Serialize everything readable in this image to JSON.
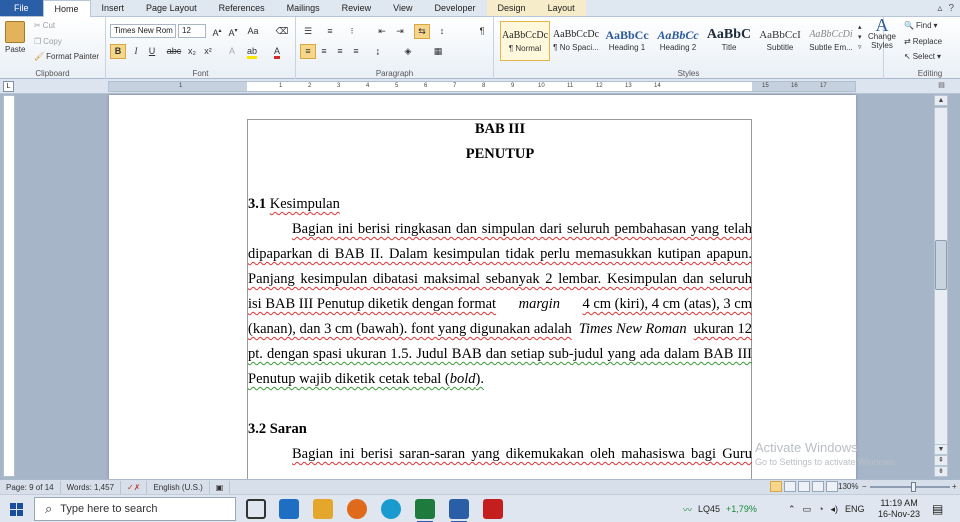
{
  "ribbon_tabs": [
    "File",
    "Home",
    "Insert",
    "Page Layout",
    "References",
    "Mailings",
    "Review",
    "View",
    "Developer",
    "Design",
    "Layout"
  ],
  "active_tab": "Home",
  "clipboard": {
    "paste": "Paste",
    "cut": "Cut",
    "copy": "Copy",
    "format_painter": "Format Painter",
    "label": "Clipboard"
  },
  "font": {
    "name": "Times New Rom",
    "size": "12",
    "label": "Font"
  },
  "paragraph": {
    "label": "Paragraph"
  },
  "styles": {
    "label": "Styles",
    "items": [
      {
        "preview": "AaBbCcDc",
        "name": "¶ Normal"
      },
      {
        "preview": "AaBbCcDc",
        "name": "¶ No Spaci..."
      },
      {
        "preview": "AaBbCc",
        "name": "Heading 1"
      },
      {
        "preview": "AaBbCc",
        "name": "Heading 2"
      },
      {
        "preview": "AaBbC",
        "name": "Title"
      },
      {
        "preview": "AaBbCcI",
        "name": "Subtitle"
      },
      {
        "preview": "AaBbCcDi",
        "name": "Subtle Em..."
      }
    ],
    "change_styles": "Change Styles"
  },
  "editing": {
    "find": "Find",
    "replace": "Replace",
    "select": "Select",
    "label": "Editing"
  },
  "ruler_numbers": [
    "1",
    "1",
    "2",
    "3",
    "4",
    "5",
    "6",
    "7",
    "8",
    "9",
    "10",
    "11",
    "12",
    "13",
    "14",
    "15",
    "16",
    "17"
  ],
  "document": {
    "title1": "BAB III",
    "title2": "PENUTUP",
    "sec1_num": "3.1",
    "sec1_title": "Kesimpulan",
    "p1": [
      "Bagian ini berisi ringkasan dan simpulan dari seluruh pembahasan yang telah",
      "dipaparkan di BAB II. Dalam kesimpulan  tidak perlu memasukkan kutipan apapun.",
      "Panjang kesimpulan dibatasi maksimal sebanyak 2 lembar. Kesimpulan dan seluruh",
      "isi BAB III Penutup diketik dengan format",
      "margin",
      "4 cm (kiri), 4 cm (atas), 3 cm",
      "(kanan), dan 3 cm (bawah). font yang digunakan adalah",
      "Times New Roman",
      "ukuran 12",
      "pt. dengan spasi ukuran 1.5. Judul BAB dan setiap sub-judul yang ada dalam BAB III",
      "Penutup wajib diketik cetak tebal (",
      "bold",
      ")."
    ],
    "sec2_num": "3.2",
    "sec2_title": "Saran",
    "p2": [
      "Bagian ini berisi saran-saran yang dikemukakan oleh mahasiswa bagi Guru"
    ]
  },
  "watermark": {
    "line1": "Activate Windows",
    "line2": "Go to Settings to activate Windows."
  },
  "statusbar": {
    "page": "Page: 9 of 14",
    "words": "Words: 1,457",
    "language": "English (U.S.)",
    "zoom": "130%"
  },
  "taskbar": {
    "search_placeholder": "Type here to search",
    "stock": "LQ45",
    "stock_change": "+1,79%",
    "lang": "ENG",
    "time": "11:19 AM",
    "date": "16-Nov-23"
  },
  "colors": {
    "file_tab": "#2a5fa8",
    "ribbon_bg": "#dfe7f1",
    "highlight": "#f6d68a",
    "stock_green": "#1a8a3a",
    "spell_red": "#d33333",
    "grammar_green": "#3a9a3a"
  }
}
